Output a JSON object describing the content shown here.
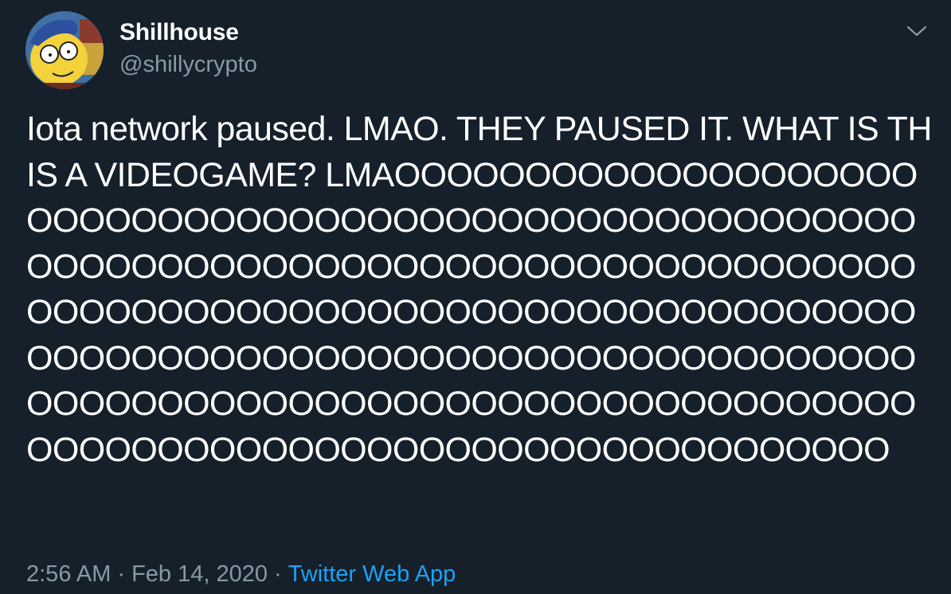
{
  "tweet": {
    "author": {
      "display_name": "Shillhouse",
      "handle": "@shillycrypto"
    },
    "text": "Iota network paused. LMAO. THEY PAUSED IT. WHAT IS THIS A VIDEOGAME? LMAOOOOOOOOOOOOOOOOOOOOOOOOOOOOOOOOOOOOOOOOOOOOOOOOOOOOOOOOOOOOOOOOOOOOOOOOOOOOOOOOOOOOOOOOOOOOOOOOOOOOOOOOOOOOOOOOOOOOOOOOOOOOOOOOOOOOOOOOOOOOOOOOOOOOOOOOOOOOOOOOOOOOOOOOOOOOOOOOOOOOOOOOOOOOOOOOOOOOOOOOOOOOOOOOOOOOOOOOOOOOOOO",
    "time": "2:56 AM",
    "separator": "·",
    "date": "Feb 14, 2020",
    "source": "Twitter Web App"
  },
  "icons": {
    "menu": "chevron-down-icon",
    "avatar": "avatar-image"
  },
  "colors": {
    "background": "#15202b",
    "secondary_text": "#8899a6",
    "link": "#1da1f2"
  }
}
